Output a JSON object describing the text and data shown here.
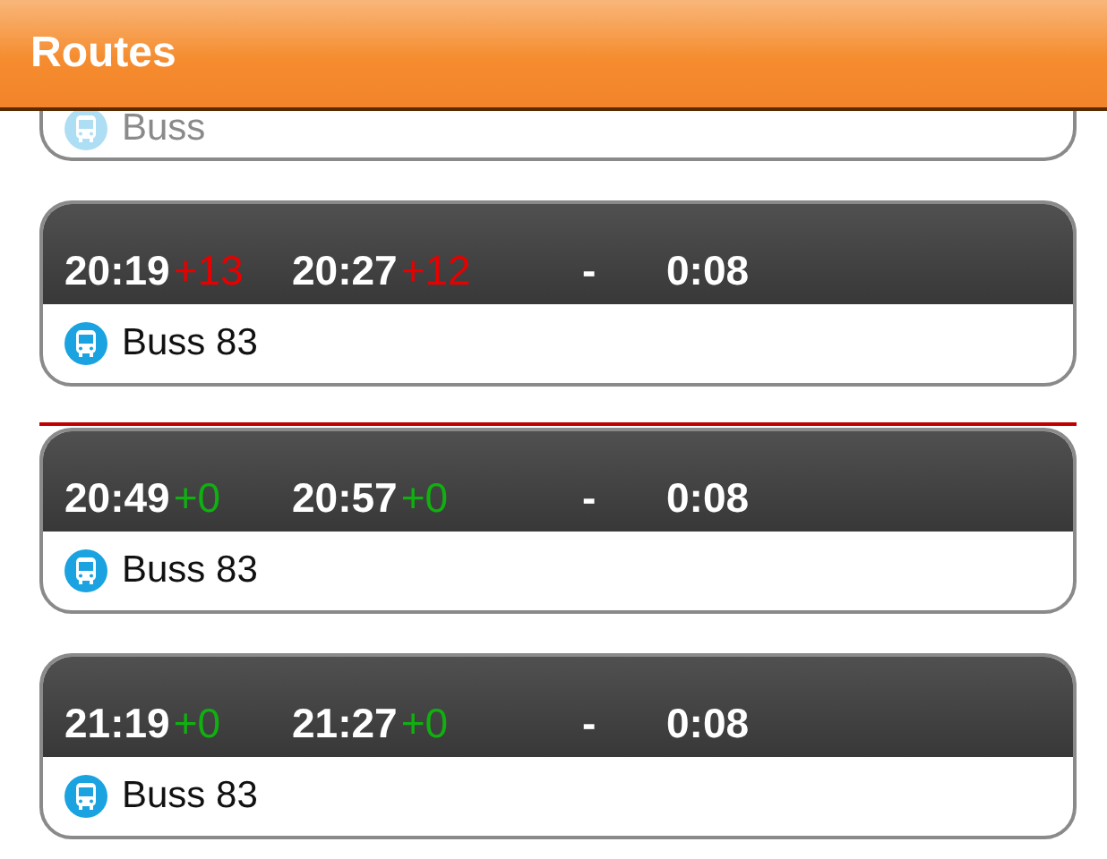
{
  "header": {
    "title": "Routes"
  },
  "items": [
    {
      "kind": "partial",
      "route": "Buss"
    },
    {
      "kind": "trip",
      "departure": "20:19",
      "departure_delay": {
        "text": "+13",
        "color": "#e60000"
      },
      "arrival": "20:27",
      "arrival_delay": {
        "text": "+12",
        "color": "#e60000"
      },
      "separator": "-",
      "duration": "0:08",
      "route": "Buss 83"
    },
    {
      "kind": "now_line"
    },
    {
      "kind": "trip",
      "departure": "20:49",
      "departure_delay": {
        "text": "+0",
        "color": "#10b010"
      },
      "arrival": "20:57",
      "arrival_delay": {
        "text": "+0",
        "color": "#10b010"
      },
      "separator": "-",
      "duration": "0:08",
      "route": "Buss 83"
    },
    {
      "kind": "trip",
      "departure": "21:19",
      "departure_delay": {
        "text": "+0",
        "color": "#10b010"
      },
      "arrival": "21:27",
      "arrival_delay": {
        "text": "+0",
        "color": "#10b010"
      },
      "separator": "-",
      "duration": "0:08",
      "route": "Buss 83"
    }
  ]
}
